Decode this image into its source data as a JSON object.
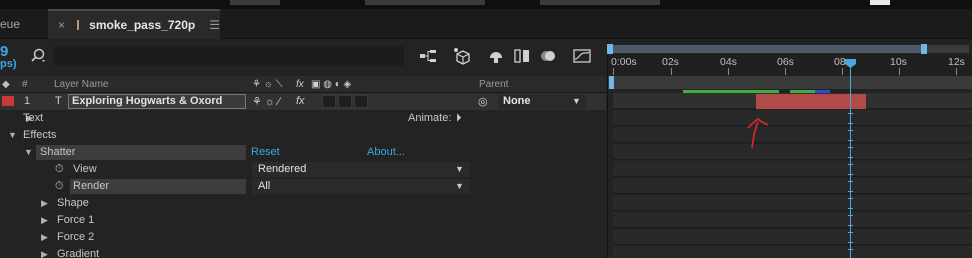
{
  "tabs": {
    "previous_label": "eue",
    "active_label": "smoke_pass_720p",
    "close_glyph": "×",
    "menu_glyph": "☰"
  },
  "toolbar": {
    "timecode": "9",
    "fps": "ps)"
  },
  "columns": {
    "layer_name": "Layer Name",
    "hash": "#",
    "parent": "Parent",
    "fx": "fx"
  },
  "layer": {
    "index": "1",
    "name": "Exploring Hogwarts & Oxord",
    "parent": "None",
    "color": "#c43a3a"
  },
  "properties": {
    "text_label": "Text",
    "animate_label": "Animate:",
    "effects_label": "Effects",
    "shatter_label": "Shatter",
    "reset_label": "Reset",
    "about_label": "About...",
    "view_label": "View",
    "view_value": "Rendered",
    "render_label": "Render",
    "render_value": "All",
    "shape_label": "Shape",
    "force1_label": "Force 1",
    "force2_label": "Force 2",
    "gradient_label": "Gradient"
  },
  "timeline": {
    "ticks": [
      "0:00s",
      "02s",
      "04s",
      "06s",
      "08s",
      "10s",
      "12s"
    ],
    "accent": "#4aa6e0",
    "layer_bar_color": "#b34a4a"
  }
}
